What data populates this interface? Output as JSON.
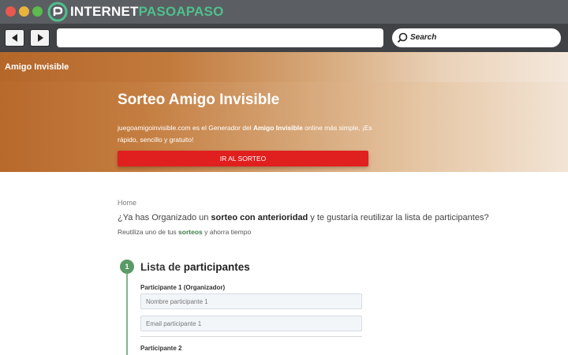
{
  "browser": {
    "brand_part1": "INTERNET",
    "brand_part2": "PASOAPASO",
    "search_placeholder": "Search",
    "colors": {
      "titlebar": "#5b5e63",
      "toolbar": "#404246",
      "brand_accent": "#4fc08d"
    }
  },
  "site": {
    "name": "Amigo Invisible"
  },
  "hero": {
    "title": "Sorteo Amigo Invisible",
    "desc_part1": "juegoamigoinvisible.com es el Generador del ",
    "desc_bold": "Amigo Invisible",
    "desc_part2": " online más simple, ¡Es rápido, sencillo y gratuito!",
    "button_label": "IR AL SORTEO",
    "button_color": "#e01f1f"
  },
  "content": {
    "breadcrumb": "Home",
    "question_part1": "¿Ya has Organizado un ",
    "question_bold": "sorteo con anterioridad",
    "question_part2": " y te gustaría reutilizar la lista de participantes?",
    "sub_part1": "Reutiliza uno de tus ",
    "sub_link": "sorteos",
    "sub_part2": " y ahorra tiempo"
  },
  "step": {
    "number": "1",
    "title_part1": "Lista de ",
    "title_bold": "participantes",
    "participants": [
      {
        "label": "Participante 1 (Organizador)",
        "name_placeholder": "Nombre participante 1",
        "email_placeholder": "Email participante 1"
      },
      {
        "label": "Participante 2"
      }
    ]
  }
}
